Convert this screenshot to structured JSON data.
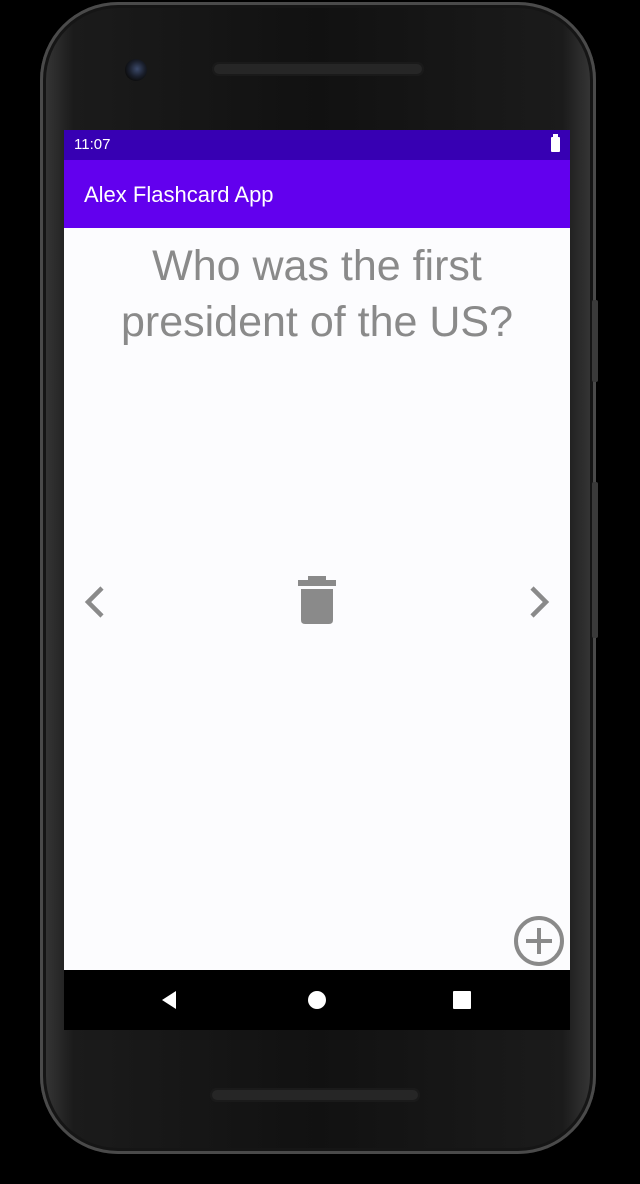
{
  "status_bar": {
    "time": "11:07",
    "battery_icon": "battery-full-icon"
  },
  "app_bar": {
    "title": "Alex Flashcard App",
    "color": "#6200ee",
    "status_color": "#3700b3"
  },
  "card": {
    "question_line1": "Who was the first",
    "question_line2": "president of the US?"
  },
  "controls": {
    "previous_icon": "chevron-left-icon",
    "delete_icon": "trash-icon",
    "next_icon": "chevron-right-icon",
    "add_icon": "add-circle-icon",
    "icon_color": "#8a8a8a"
  },
  "system_nav": {
    "back_icon": "back-triangle-icon",
    "home_icon": "home-circle-icon",
    "recents_icon": "recents-square-icon"
  }
}
